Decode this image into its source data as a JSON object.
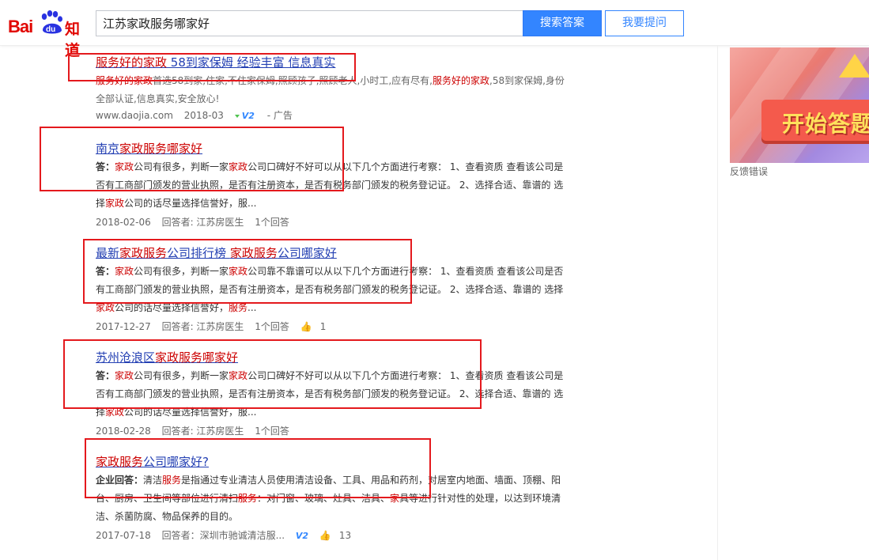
{
  "header": {
    "logo_text_bai": "Bai",
    "logo_text_du": "du",
    "logo_text_zhidao": "知道",
    "search_value": "江苏家政服务哪家好",
    "search_button": "搜索答案",
    "ask_button": "我要提问"
  },
  "sidebar": {
    "ad_text": "开始答题",
    "feedback": "反馈错误"
  },
  "results": [
    {
      "type": "ad",
      "title_parts": [
        "服务好的家政",
        " 58到家保姆 经验丰富 信息真实"
      ],
      "abstract": {
        "p1": "服务好的家政",
        "p2": "首选58到家,住家,不住家保姆,照顾孩子,照顾老人,小时工,应有尽有,",
        "p3": "服务好的家政",
        "p4": ",58到家保姆,身份全部认证,信息真实,安全放心!"
      },
      "meta": {
        "site": "www.daojia.com",
        "date": "2018-03",
        "v2": "V2",
        "tag": "- 广告"
      }
    },
    {
      "title_parts": [
        "南京",
        "家政服务哪家好"
      ],
      "abstract": {
        "prefix": "答：",
        "a": "家政",
        "b": "公司有很多，判断一家",
        "c": "家政",
        "d": "公司口碑好不好可以从以下几个方面进行考察： 1、查看资质 查看该公司是否有工商部门颁发的营业执照，是否有注册资本，是否有税务部门颁发的税务登记证。 2、选择合适、靠谱的 选择",
        "e": "家政",
        "f": "公司的话尽量选择信誉好，服..."
      },
      "meta": {
        "date": "2018-02-06",
        "answerer": "回答者: 江苏房医生",
        "count": "1个回答"
      }
    },
    {
      "title_parts": [
        "最新",
        "家政服务",
        "公司排行榜 ",
        "家政服务",
        "公司哪家好"
      ],
      "abstract": {
        "prefix": "答：",
        "a": "家政",
        "b": "公司有很多，判断一家",
        "c": "家政",
        "d": "公司靠不靠谱可以从以下几个方面进行考察： 1、查看资质 查看该公司是否有工商部门颁发的营业执照，是否有注册资本，是否有税务部门颁发的税务登记证。 2、选择合适、靠谱的 选择",
        "e": "家政",
        "f": "公司的话尽量选择信誉好，",
        "g": "服务",
        "h": "..."
      },
      "meta": {
        "date": "2017-12-27",
        "answerer": "回答者: 江苏房医生",
        "count": "1个回答",
        "likes": "1"
      }
    },
    {
      "title_parts": [
        "苏州沧浪区",
        "家政服务哪家好"
      ],
      "abstract": {
        "prefix": "答：",
        "a": "家政",
        "b": "公司有很多，判断一家",
        "c": "家政",
        "d": "公司口碑好不好可以从以下几个方面进行考察： 1、查看资质 查看该公司是否有工商部门颁发的营业执照，是否有注册资本，是否有税务部门颁发的税务登记证。 2、选择合适、靠谱的 选择",
        "e": "家政",
        "f": "公司的话尽量选择信誉好，服..."
      },
      "meta": {
        "date": "2018-02-28",
        "answerer": "回答者: 江苏房医生",
        "count": "1个回答"
      }
    },
    {
      "title_parts": [
        "家政服务",
        "公司哪家好?"
      ],
      "abstract": {
        "prefix": "企业回答：",
        "a": "清洁",
        "b": "服务",
        "c": "是指通过专业清洁人员使用清洁设备、工具、用品和药剂，对居室内地面、墙面、顶棚、阳台、厨房、卫生间等部位进行清扫",
        "d": "服务",
        "e": "：对门窗、玻璃、灶具、洁具、",
        "f": "家",
        "g": "具等进行针对性的处理，以达到环境清洁、杀菌防腐、物品保养的目的。"
      },
      "meta": {
        "date": "2017-07-18",
        "answerer": "回答者：深圳市驰诚清洁服...",
        "v2": "V2",
        "likes": "13"
      }
    }
  ],
  "colors": {
    "link": "#2440b3",
    "highlight": "#cc0000",
    "annotation_red": "#e4191d",
    "search_blue": "#3385ff"
  }
}
